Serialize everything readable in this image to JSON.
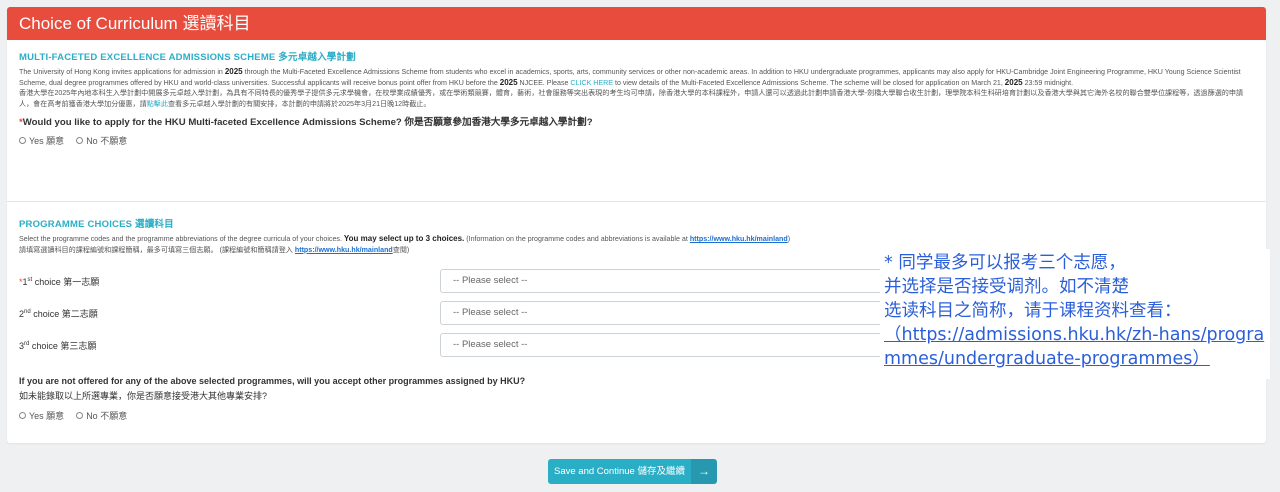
{
  "header": {
    "title": "Choice of Curriculum 選讀科目"
  },
  "mfea": {
    "title": "MULTI-FACETED EXCELLENCE ADMISSIONS SCHEME 多元卓越入學計劃",
    "desc_en_1": "The University of Hong Kong invites applications for admission in ",
    "year1": "2025",
    "desc_en_2": " through the Multi-Faceted Excellence Admissions Scheme from students who excel in academics, sports, arts, community services or other non-academic areas. In addition to HKU undergraduate programmes, applicants may also apply for HKU-Cambridge Joint Engineering Programme, HKU Young Science Scientist Scheme, dual degree programmes offered by HKU and world-class universities. Successful applicants will receive bonus point offer from HKU before the ",
    "year2": "2025",
    "desc_en_3": " NJCEE. Please ",
    "click_here": "CLICK HERE",
    "desc_en_4": " to view details of the Multi-Faceted Excellence Admissions Scheme. The scheme will be closed for application on March 21, ",
    "year3": "2025",
    "desc_en_5": " 23:59 midnight.",
    "desc_zh_1": "香港大學在2025年內地本科生入學計劃中開展多元卓越入學計劃，為具有不同特長的優秀學子提供多元求學機會，在校學業成績優秀，或在學術類競賽，體育，藝術，社會服務等突出表現的考生均可申請，除香港大學的本科課程外，申請人還可以透過此計劃申請香港大學-劍橋大學聯合收生計劃，理學院本科生科研培育計劃以及香港大學與其它海外名校的聯合雙學位課程等，透過篩選的申請人，會在高考前獲香港大學加分優惠，請",
    "click_zh": "點擊此",
    "desc_zh_2": "查看多元卓越入學計劃的有關安排，本計劃的申請將於2025年3月21日晚12時截止。",
    "question": "Would you like to apply for the HKU Multi-faceted Excellence Admissions Scheme? 你是否願意參加香港大學多元卓越入學計劃?",
    "opt_yes": "Yes 願意",
    "opt_no": "No 不願意"
  },
  "programme": {
    "title": "PROGRAMME CHOICES 選讀科目",
    "desc_1": "Select the programme codes and the programme abbreviations of the degree curricula of your choices. ",
    "desc_bold": "You may select up to 3 choices.",
    "desc_2": " (Information on the programme codes and abbreviations is available at ",
    "link": "https://www.hku.hk/mainland",
    "desc_3": ")",
    "desc_zh_1": "請填寫選讀科目的課程編號和課程簡稱，最多可填寫三個志願。 (課程編號和簡稱請登入 ",
    "desc_zh_2": "查閱)",
    "choices": [
      {
        "num": "1",
        "sup": "st",
        "label": " choice 第一志願",
        "placeholder": "-- Please select --"
      },
      {
        "num": "2",
        "sup": "nd",
        "label": " choice  第二志願",
        "placeholder": "-- Please select --"
      },
      {
        "num": "3",
        "sup": "rd",
        "label": " choice  第三志願",
        "placeholder": "-- Please select --"
      }
    ],
    "q2_en": "If you are not offered for any of the above selected programmes, will you accept other programmes assigned by HKU?",
    "q2_zh": "如未能錄取以上所選專業，你是否願意接受港大其他專業安排?",
    "opt_yes": "Yes 願意",
    "opt_no": "No 不願意"
  },
  "overlay": {
    "line1": "* 同学最多可以报考三个志愿，",
    "line2": "并选择是否接受调剂。如不清楚",
    "line3": "选读科目之简称，请于课程资料查看：",
    "url": "（https://admissions.hku.hk/zh-hans/programmes/undergraduate-programmes）"
  },
  "footer": {
    "save_label": "Save and Continue 儲存及繼續",
    "arrow": "→"
  },
  "colors": {
    "header_bg": "#e84c3d",
    "accent": "#2aaec6",
    "link": "#1a6fd1",
    "overlay_text": "#2b5fd9"
  }
}
